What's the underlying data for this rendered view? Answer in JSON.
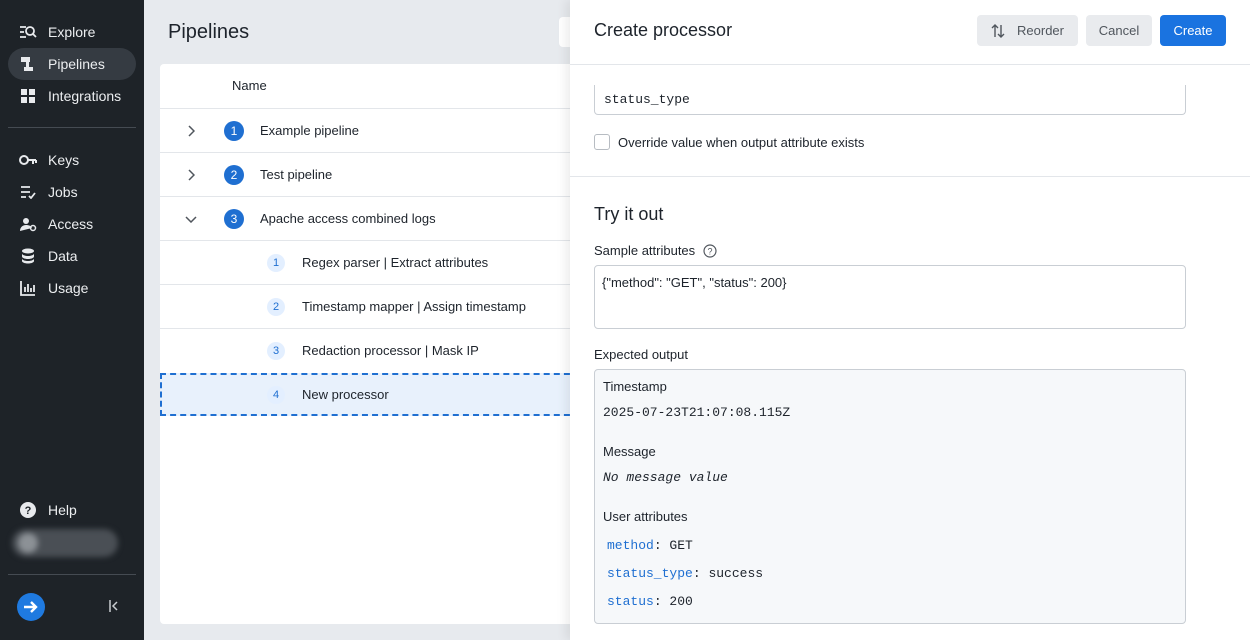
{
  "sidebar": {
    "items": [
      {
        "label": "Explore",
        "icon": "explore-icon"
      },
      {
        "label": "Pipelines",
        "icon": "pipelines-icon",
        "active": true
      },
      {
        "label": "Integrations",
        "icon": "integrations-icon"
      },
      {
        "label": "Keys",
        "icon": "key-icon"
      },
      {
        "label": "Jobs",
        "icon": "jobs-icon"
      },
      {
        "label": "Access",
        "icon": "access-icon"
      },
      {
        "label": "Data",
        "icon": "database-icon"
      },
      {
        "label": "Usage",
        "icon": "bar-chart-icon"
      }
    ],
    "help_label": "Help"
  },
  "main": {
    "title": "Pipelines",
    "table": {
      "column_name": "Name",
      "rows": [
        {
          "num": "1",
          "name": "Example pipeline",
          "expanded": false
        },
        {
          "num": "2",
          "name": "Test pipeline",
          "expanded": false
        },
        {
          "num": "3",
          "name": "Apache access combined logs",
          "expanded": true
        }
      ],
      "processors": [
        {
          "num": "1",
          "name": "Regex parser  |  Extract attributes"
        },
        {
          "num": "2",
          "name": "Timestamp mapper  |  Assign timestamp"
        },
        {
          "num": "3",
          "name": "Redaction processor  |  Mask IP"
        },
        {
          "num": "4",
          "name": "New processor"
        }
      ]
    }
  },
  "drawer": {
    "title": "Create processor",
    "reorder_label": "Reorder",
    "cancel_label": "Cancel",
    "create_label": "Create",
    "output_attribute_value": "status_type",
    "override_label": "Override value when output attribute exists",
    "try_title": "Try it out",
    "sample_label": "Sample attributes",
    "sample_value": "{\"method\": \"GET\", \"status\": 200}",
    "expected_label": "Expected output",
    "output": {
      "timestamp_label": "Timestamp",
      "timestamp_value": "2025-07-23T21:07:08.115Z",
      "message_label": "Message",
      "message_value": "No message value",
      "attributes_label": "User attributes",
      "attributes": [
        {
          "key": "method",
          "value": "GET"
        },
        {
          "key": "status_type",
          "value": "success"
        },
        {
          "key": "status",
          "value": "200"
        }
      ]
    }
  },
  "colors": {
    "accent": "#1a73e0",
    "sidebar_bg": "#1e2328"
  }
}
